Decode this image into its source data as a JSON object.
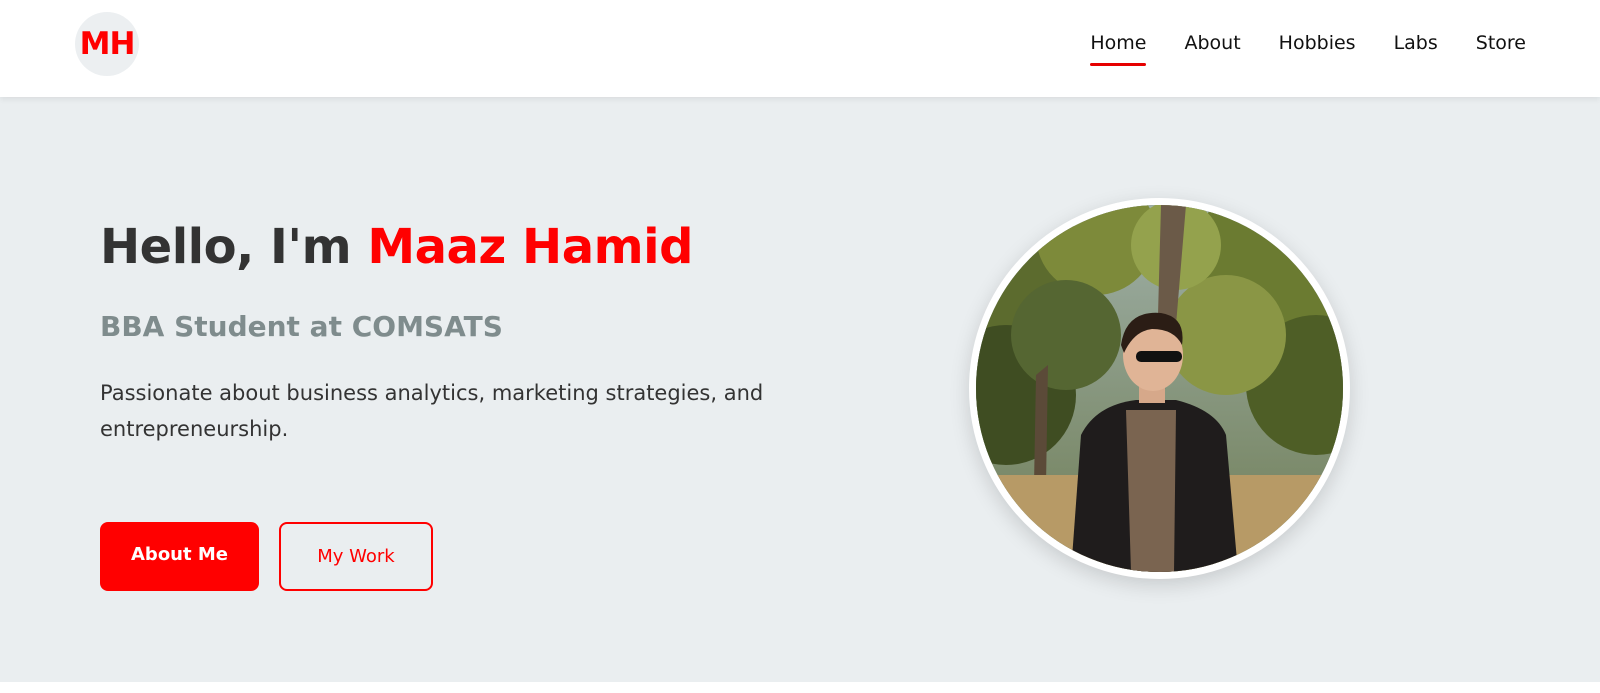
{
  "header": {
    "logo_text": "MH",
    "nav": [
      {
        "label": "Home",
        "active": true
      },
      {
        "label": "About",
        "active": false
      },
      {
        "label": "Hobbies",
        "active": false
      },
      {
        "label": "Labs",
        "active": false
      },
      {
        "label": "Store",
        "active": false
      }
    ]
  },
  "hero": {
    "greeting": "Hello, I'm ",
    "name": "Maaz Hamid",
    "subtitle": "BBA Student at COMSATS",
    "description": "Passionate about business analytics, marketing strategies, and entrepreneurship.",
    "primary_button": "About Me",
    "secondary_button": "My Work"
  },
  "colors": {
    "accent": "#ff0000",
    "hero_background": "#eaeef0",
    "text_dark": "#333333",
    "subtitle_gray": "#7f8c8d"
  }
}
